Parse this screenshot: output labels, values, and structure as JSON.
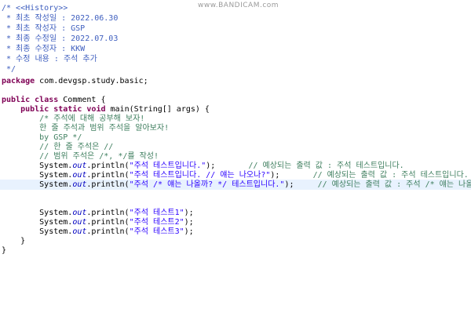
{
  "watermark": "www.BANDICAM.com",
  "header_comment": {
    "l1": "/* <<History>>",
    "l2": " * 최초 작성일 : 2022.06.30",
    "l3": " * 최초 작성자 : GSP",
    "l4": " * 최종 수정일 : 2022.07.03",
    "l5": " * 최종 수정자 : KKW",
    "l6": " * 수정 내용 : 주석 추가",
    "l7": " */"
  },
  "package_line": {
    "keyword": "package",
    "name": " com.devgsp.study.basic;"
  },
  "class_decl": {
    "kw1": "public",
    "kw2": "class",
    "rest": " Comment {"
  },
  "method_decl": {
    "indent": "    ",
    "kw1": "public",
    "kw2": "static",
    "kw3": "void",
    "rest": " main(String[] args) {"
  },
  "block_comment": {
    "l1": "        /* 주석에 대해 공부해 보자!",
    "l2": "        한 줄 주석과 범위 주석을 알아보자!",
    "l3": "        by GSP */"
  },
  "line_comments": {
    "l1": "        // 한 줄 주석은 //",
    "l2": "        // 범위 주석은 /*, */를 작성!"
  },
  "print_lines": [
    {
      "obj": "        System.",
      "field": "out",
      "call": ".println(",
      "str": "\"주석 테스트입니다.\"",
      "close": ");",
      "gap": "       ",
      "comment": "// 예상되는 출력 값 : 주석 테스트입니다."
    },
    {
      "obj": "        System.",
      "field": "out",
      "call": ".println(",
      "str": "\"주석 테스트입니다. // 얘는 나오나?\"",
      "close": ");",
      "gap": "       ",
      "comment": "// 예상되는 출력 값 : 주석 테스트입니다. // 얘는 나오나?"
    },
    {
      "obj": "        System.",
      "field": "out",
      "call": ".println(",
      "str": "\"주석 /* 얘는 나올까? */ 테스트입니다.\"",
      "close": ");",
      "gap": "     ",
      "comment": "// 예상되는 출력 값 : 주석 /* 얘는 나올까? */ 테스트입니다."
    },
    {
      "obj": "        System.",
      "field": "out",
      "call": ".println(",
      "str": "\"주석 테스트1\"",
      "close": ");",
      "gap": "",
      "comment": ""
    },
    {
      "obj": "        System.",
      "field": "out",
      "call": ".println(",
      "str": "\"주석 테스트2\"",
      "close": ");",
      "gap": "",
      "comment": ""
    },
    {
      "obj": "        System.",
      "field": "out",
      "call": ".println(",
      "str": "\"주석 테스트3\"",
      "close": ");",
      "gap": "",
      "comment": ""
    }
  ],
  "closing": {
    "method": "    }",
    "class": "}"
  },
  "colors": {
    "javadoc": "#3f5fbf",
    "comment": "#3f7f5f",
    "keyword": "#7f0055",
    "string": "#2a00ff",
    "field": "#0000c0",
    "current_line": "#e8f2fe"
  }
}
